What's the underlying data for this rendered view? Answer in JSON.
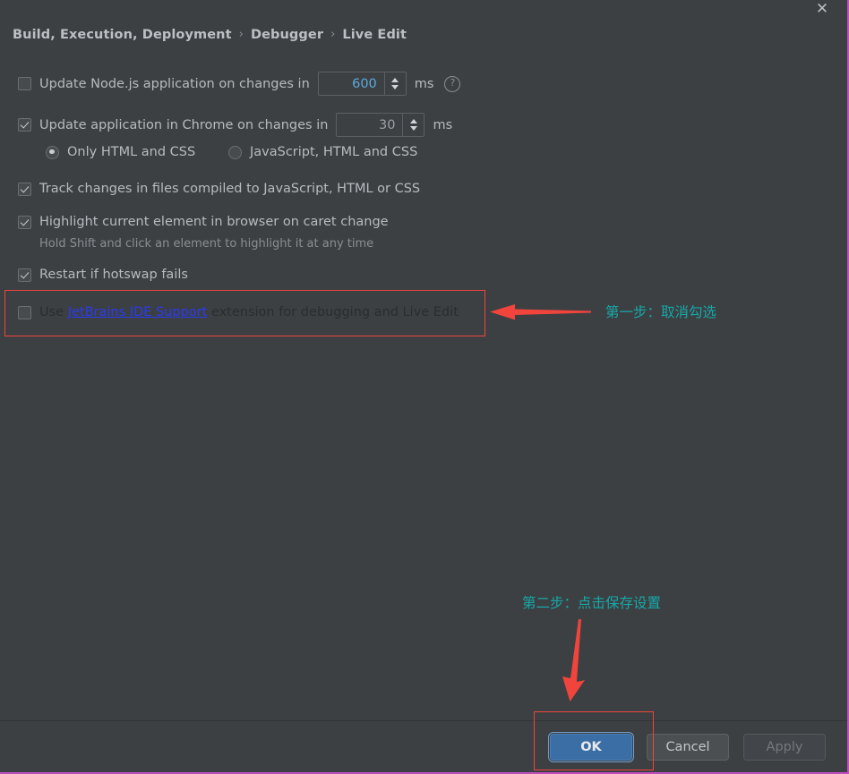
{
  "window": {
    "close_icon": "close-icon",
    "background_color": "#3c4043",
    "accent_color": "#3a6ea5",
    "highlight_color": "#f0443c",
    "annotation_color": "#17a8a8"
  },
  "breadcrumb": {
    "items": [
      "Build, Execution, Deployment",
      "Debugger",
      "Live Edit"
    ],
    "separator": "›"
  },
  "settings": {
    "node_update": {
      "label": "Update Node.js application on changes in",
      "checked": false,
      "value": "600",
      "unit": "ms",
      "help": "?"
    },
    "chrome_update": {
      "label": "Update application in Chrome on changes in",
      "checked": true,
      "value": "30",
      "unit": "ms"
    },
    "radios": [
      {
        "label": "Only HTML and CSS",
        "selected": true
      },
      {
        "label": "JavaScript, HTML and CSS",
        "selected": false
      }
    ],
    "track_changes": {
      "label": "Track changes in files compiled to JavaScript, HTML or CSS",
      "checked": true
    },
    "highlight_element": {
      "label": "Highlight current element in browser on caret change",
      "checked": true,
      "hint": "Hold Shift and click an element to highlight it at any time"
    },
    "restart_hotswap": {
      "label": "Restart if hotswap fails",
      "checked": true
    },
    "jetbrains_extension": {
      "prefix": "Use ",
      "link": "JetBrains IDE Support",
      "suffix": " extension for debugging and Live Edit",
      "checked": false
    }
  },
  "annotations": [
    {
      "text": "第一步：取消勾选"
    },
    {
      "text": "第二步：点击保存设置"
    }
  ],
  "buttons": {
    "ok": "OK",
    "cancel": "Cancel",
    "apply": "Apply"
  }
}
